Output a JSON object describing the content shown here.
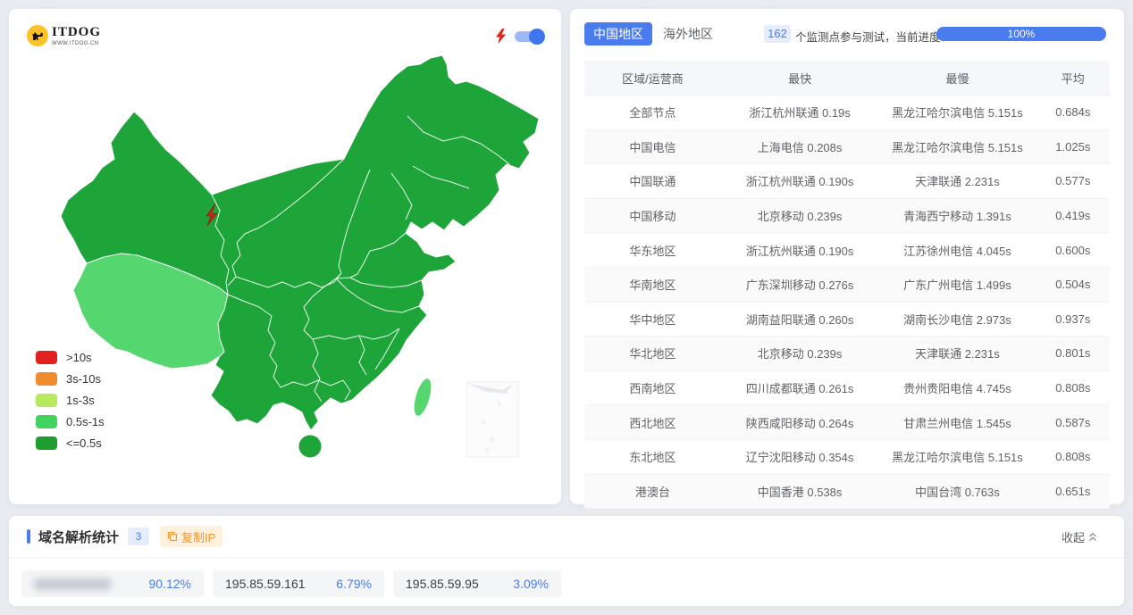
{
  "map_panel": {
    "logo": {
      "title": "ITDOG",
      "subtitle": "WWW.ITDOG.CN"
    },
    "legend": [
      {
        "label": ">10s",
        "color": "#e32020"
      },
      {
        "label": "3s-10s",
        "color": "#f08c2e"
      },
      {
        "label": "1s-3s",
        "color": "#b7e95e"
      },
      {
        "label": "0.5s-1s",
        "color": "#41d35e"
      },
      {
        "label": "<=0.5s",
        "color": "#1e9e31"
      }
    ],
    "map_colors": {
      "fast": "#1da53a",
      "medium": "#55d66f",
      "marker": "#c8251a"
    }
  },
  "result_panel": {
    "tabs": [
      {
        "label": "中国地区"
      },
      {
        "label": "海外地区"
      }
    ],
    "monitor_count": "162",
    "monitor_text": "个监测点参与测试，当前进度：",
    "progress_label": "100%",
    "table": {
      "columns": [
        "区域/运营商",
        "最快",
        "最慢",
        "平均"
      ],
      "rows": [
        [
          "全部节点",
          "浙江杭州联通 0.19s",
          "黑龙江哈尔滨电信 5.151s",
          "0.684s"
        ],
        [
          "中国电信",
          "上海电信 0.208s",
          "黑龙江哈尔滨电信 5.151s",
          "1.025s"
        ],
        [
          "中国联通",
          "浙江杭州联通 0.190s",
          "天津联通 2.231s",
          "0.577s"
        ],
        [
          "中国移动",
          "北京移动 0.239s",
          "青海西宁移动 1.391s",
          "0.419s"
        ],
        [
          "华东地区",
          "浙江杭州联通 0.190s",
          "江苏徐州电信 4.045s",
          "0.600s"
        ],
        [
          "华南地区",
          "广东深圳移动 0.276s",
          "广东广州电信 1.499s",
          "0.504s"
        ],
        [
          "华中地区",
          "湖南益阳联通 0.260s",
          "湖南长沙电信 2.973s",
          "0.937s"
        ],
        [
          "华北地区",
          "北京移动 0.239s",
          "天津联通 2.231s",
          "0.801s"
        ],
        [
          "西南地区",
          "四川成都联通 0.261s",
          "贵州贵阳电信 4.745s",
          "0.808s"
        ],
        [
          "西北地区",
          "陕西咸阳移动 0.264s",
          "甘肃兰州电信 1.545s",
          "0.587s"
        ],
        [
          "东北地区",
          "辽宁沈阳移动 0.354s",
          "黑龙江哈尔滨电信 5.151s",
          "0.808s"
        ],
        [
          "港澳台",
          "中国香港 0.538s",
          "中国台湾 0.763s",
          "0.651s"
        ]
      ]
    }
  },
  "dns_panel": {
    "title": "域名解析统计",
    "count": "3",
    "copy_ip_label": "复制IP",
    "collapse_label": "收起",
    "entries": [
      {
        "ip": "",
        "redacted": true,
        "percent": "90.12%"
      },
      {
        "ip": "195.85.59.161",
        "redacted": false,
        "percent": "6.79%"
      },
      {
        "ip": "195.85.59.95",
        "redacted": false,
        "percent": "3.09%"
      }
    ]
  }
}
